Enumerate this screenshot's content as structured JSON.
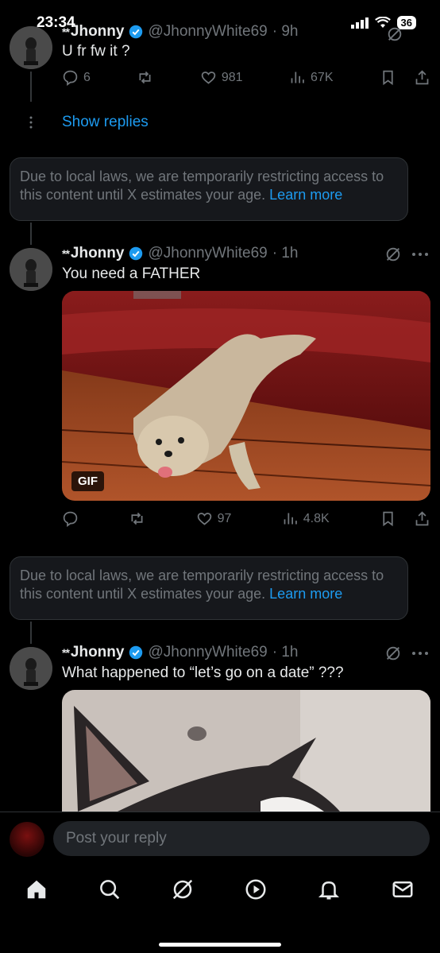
{
  "status_bar": {
    "time": "23:34",
    "battery": "36"
  },
  "tweets": [
    {
      "name": "Jhonny",
      "name_prefix": "**",
      "handle": "@JhonnyWhite69",
      "age": "· 9h",
      "text": "U fr fw it ?",
      "replies": "6",
      "likes": "981",
      "views": "67K"
    },
    {
      "name": "Jhonny",
      "name_prefix": "**",
      "handle": "@JhonnyWhite69",
      "age": "· 1h",
      "text": "You need a FATHER",
      "gif_label": "GIF",
      "likes": "97",
      "views": "4.8K"
    },
    {
      "name": "Jhonny",
      "name_prefix": "**",
      "handle": "@JhonnyWhite69",
      "age": "· 1h",
      "text": "What happened to “let’s go on a date” ???"
    }
  ],
  "show_replies": "Show replies",
  "notice": {
    "text": "Due to local laws, we are temporarily restricting access to this content until X estimates your age. ",
    "link": "Learn more"
  },
  "reply_box": {
    "placeholder": "Post your reply"
  },
  "colors": {
    "accent": "#1d9bf0",
    "muted": "#71767b",
    "background": "#000000"
  },
  "nav_icons": [
    "home-icon",
    "search-icon",
    "grok-icon",
    "video-icon",
    "bell-icon",
    "mail-icon"
  ]
}
